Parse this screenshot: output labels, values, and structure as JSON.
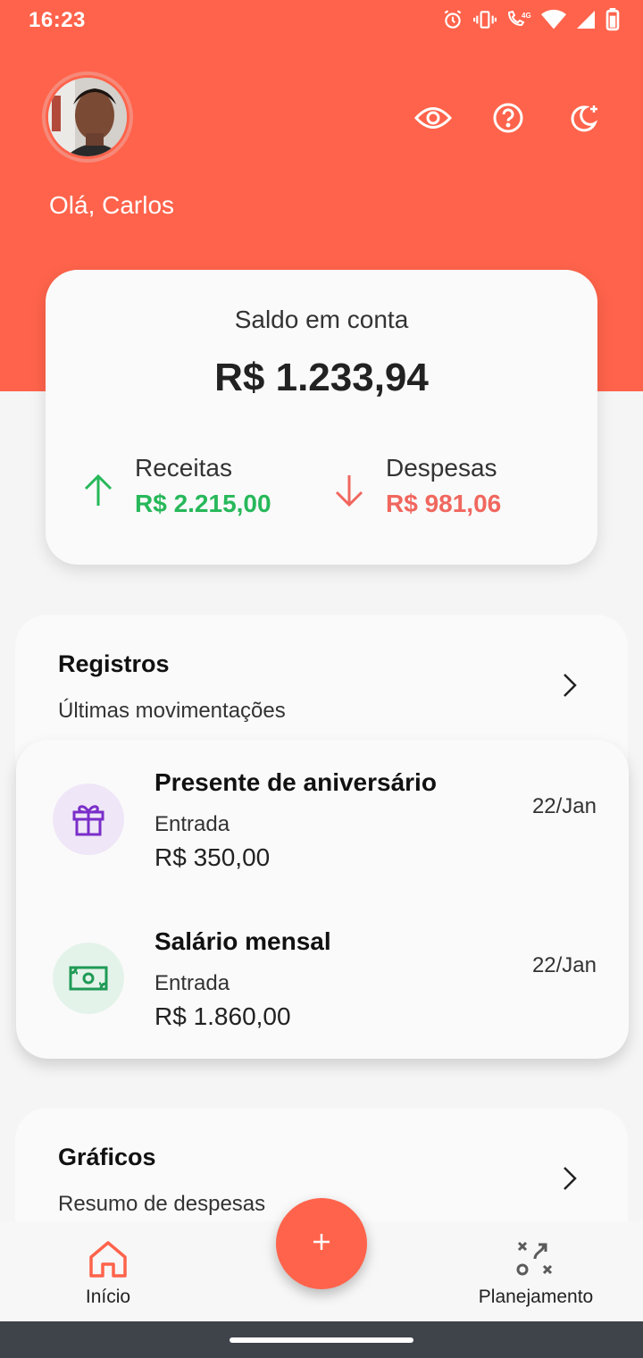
{
  "status_bar": {
    "time": "16:23",
    "icons": [
      "alarm-icon",
      "vibrate-icon",
      "volte-4g-icon",
      "wifi-icon",
      "signal-icon",
      "battery-icon"
    ]
  },
  "header": {
    "greeting": "Olá, Carlos",
    "actions": [
      "eye-icon",
      "help-icon",
      "dark-mode-icon"
    ],
    "color": "#ff634b"
  },
  "balance": {
    "label": "Saldo em conta",
    "value": "R$ 1.233,94",
    "income": {
      "label": "Receitas",
      "value": "R$ 2.215,00",
      "color": "#27b85a"
    },
    "expenses": {
      "label": "Despesas",
      "value": "R$ 981,06",
      "color": "#f0675e"
    }
  },
  "records": {
    "title": "Registros",
    "subtitle": "Últimas movimentações",
    "items": [
      {
        "title": "Presente de aniversário",
        "type": "Entrada",
        "amount": "R$ 350,00",
        "date": "22/Jan",
        "icon": "gift-icon",
        "icon_color": "#7a2ec9",
        "icon_bg": "#efe6f7"
      },
      {
        "title": "Salário mensal",
        "type": "Entrada",
        "amount": "R$ 1.860,00",
        "date": "22/Jan",
        "icon": "money-icon",
        "icon_color": "#1f9a55",
        "icon_bg": "#e4f3ea"
      }
    ]
  },
  "charts": {
    "title": "Gráficos",
    "subtitle": "Resumo de despesas"
  },
  "bottom_nav": {
    "home_label": "Início",
    "planning_label": "Planejamento",
    "fab_icon": "plus-icon"
  }
}
